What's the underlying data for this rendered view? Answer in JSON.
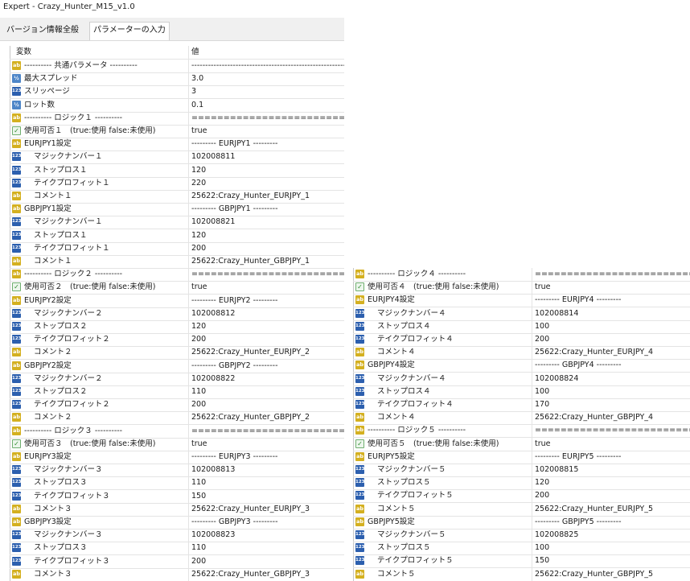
{
  "window": {
    "title": "Expert - Crazy_Hunter_M15_v1.0"
  },
  "tabs": [
    {
      "label": "バージョン情報",
      "active": false
    },
    {
      "label": "全般",
      "active": false
    },
    {
      "label": "パラメーターの入力",
      "active": true
    }
  ],
  "table": {
    "columns": {
      "variable": "変数",
      "value": "値"
    },
    "left_rows": [
      {
        "icon": "ab",
        "name": "----------   共通パラメータ   ----------",
        "value": "-------------------------------------------------------------------------------",
        "indent": false
      },
      {
        "icon": "half",
        "name": "最大スプレッド",
        "value": "3.0",
        "indent": false
      },
      {
        "icon": "123",
        "name": "スリッページ",
        "value": "3",
        "indent": false
      },
      {
        "icon": "half",
        "name": "ロット数",
        "value": "0.1",
        "indent": false
      },
      {
        "icon": "ab",
        "name": "----------   ロジック１   ----------",
        "value": "=====================================",
        "indent": false
      },
      {
        "icon": "bool",
        "name": "使用可否１　(true:使用  false:未使用)",
        "value": "true",
        "indent": false
      },
      {
        "icon": "ab",
        "name": "EURJPY1設定",
        "value": "---------  EURJPY1 ---------",
        "indent": false
      },
      {
        "icon": "123",
        "name": "マジックナンバー１",
        "value": "102008811",
        "indent": true
      },
      {
        "icon": "123",
        "name": "ストップロス１",
        "value": "120",
        "indent": true
      },
      {
        "icon": "123",
        "name": "テイクプロフィット１",
        "value": "220",
        "indent": true
      },
      {
        "icon": "ab",
        "name": "コメント１",
        "value": "25622:Crazy_Hunter_EURJPY_1",
        "indent": true
      },
      {
        "icon": "ab",
        "name": "GBPJPY1設定",
        "value": "---------  GBPJPY1 ---------",
        "indent": false
      },
      {
        "icon": "123",
        "name": "マジックナンバー１",
        "value": "102008821",
        "indent": true
      },
      {
        "icon": "123",
        "name": "ストップロス１",
        "value": "120",
        "indent": true
      },
      {
        "icon": "123",
        "name": "テイクプロフィット１",
        "value": "200",
        "indent": true
      },
      {
        "icon": "ab",
        "name": "コメント１",
        "value": "25622:Crazy_Hunter_GBPJPY_1",
        "indent": true
      },
      {
        "icon": "ab",
        "name": "----------   ロジック２   ----------",
        "value": "=====================================",
        "indent": false
      },
      {
        "icon": "bool",
        "name": "使用可否２　(true:使用  false:未使用)",
        "value": "true",
        "indent": false
      },
      {
        "icon": "ab",
        "name": "EURJPY2設定",
        "value": "---------  EURJPY2 ---------",
        "indent": false
      },
      {
        "icon": "123",
        "name": "マジックナンバー２",
        "value": "102008812",
        "indent": true
      },
      {
        "icon": "123",
        "name": "ストップロス２",
        "value": "120",
        "indent": true
      },
      {
        "icon": "123",
        "name": "テイクプロフィット２",
        "value": "200",
        "indent": true
      },
      {
        "icon": "ab",
        "name": "コメント２",
        "value": "25622:Crazy_Hunter_EURJPY_2",
        "indent": true
      },
      {
        "icon": "ab",
        "name": "GBPJPY2設定",
        "value": "---------  GBPJPY2 ---------",
        "indent": false
      },
      {
        "icon": "123",
        "name": "マジックナンバー２",
        "value": "102008822",
        "indent": true
      },
      {
        "icon": "123",
        "name": "ストップロス２",
        "value": "110",
        "indent": true
      },
      {
        "icon": "123",
        "name": "テイクプロフィット２",
        "value": "200",
        "indent": true
      },
      {
        "icon": "ab",
        "name": "コメント２",
        "value": "25622:Crazy_Hunter_GBPJPY_2",
        "indent": true
      },
      {
        "icon": "ab",
        "name": "----------   ロジック３   ----------",
        "value": "=====================================",
        "indent": false
      },
      {
        "icon": "bool",
        "name": "使用可否３　(true:使用  false:未使用)",
        "value": "true",
        "indent": false
      },
      {
        "icon": "ab",
        "name": "EURJPY3設定",
        "value": "---------  EURJPY3 ---------",
        "indent": false
      },
      {
        "icon": "123",
        "name": "マジックナンバー３",
        "value": "102008813",
        "indent": true
      },
      {
        "icon": "123",
        "name": "ストップロス３",
        "value": "110",
        "indent": true
      },
      {
        "icon": "123",
        "name": "テイクプロフィット３",
        "value": "150",
        "indent": true
      },
      {
        "icon": "ab",
        "name": "コメント３",
        "value": "25622:Crazy_Hunter_EURJPY_3",
        "indent": true
      },
      {
        "icon": "ab",
        "name": "GBPJPY3設定",
        "value": "---------  GBPJPY3 ---------",
        "indent": false
      },
      {
        "icon": "123",
        "name": "マジックナンバー３",
        "value": "102008823",
        "indent": true
      },
      {
        "icon": "123",
        "name": "ストップロス３",
        "value": "110",
        "indent": true
      },
      {
        "icon": "123",
        "name": "テイクプロフィット３",
        "value": "200",
        "indent": true
      },
      {
        "icon": "ab",
        "name": "コメント３",
        "value": "25622:Crazy_Hunter_GBPJPY_3",
        "indent": true
      }
    ],
    "right_rows": [
      {
        "icon": "ab",
        "name": "----------   ロジック４   ----------",
        "value": "=====================================",
        "indent": false
      },
      {
        "icon": "bool",
        "name": "使用可否４　(true:使用  false:未使用)",
        "value": "true",
        "indent": false
      },
      {
        "icon": "ab",
        "name": "EURJPY4設定",
        "value": "---------  EURJPY4 ---------",
        "indent": false
      },
      {
        "icon": "123",
        "name": "マジックナンバー４",
        "value": "102008814",
        "indent": true
      },
      {
        "icon": "123",
        "name": "ストップロス４",
        "value": "100",
        "indent": true
      },
      {
        "icon": "123",
        "name": "テイクプロフィット４",
        "value": "200",
        "indent": true
      },
      {
        "icon": "ab",
        "name": "コメント４",
        "value": "25622:Crazy_Hunter_EURJPY_4",
        "indent": true
      },
      {
        "icon": "ab",
        "name": "GBPJPY4設定",
        "value": "---------  GBPJPY4 ---------",
        "indent": false
      },
      {
        "icon": "123",
        "name": "マジックナンバー４",
        "value": "102008824",
        "indent": true
      },
      {
        "icon": "123",
        "name": "ストップロス４",
        "value": "100",
        "indent": true
      },
      {
        "icon": "123",
        "name": "テイクプロフィット４",
        "value": "170",
        "indent": true
      },
      {
        "icon": "ab",
        "name": "コメント４",
        "value": "25622:Crazy_Hunter_GBPJPY_4",
        "indent": true
      },
      {
        "icon": "ab",
        "name": "----------   ロジック５   ----------",
        "value": "=====================================",
        "indent": false
      },
      {
        "icon": "bool",
        "name": "使用可否５　(true:使用  false:未使用)",
        "value": "true",
        "indent": false
      },
      {
        "icon": "ab",
        "name": "EURJPY5設定",
        "value": "---------  EURJPY5 ---------",
        "indent": false
      },
      {
        "icon": "123",
        "name": "マジックナンバー５",
        "value": "102008815",
        "indent": true
      },
      {
        "icon": "123",
        "name": "ストップロス５",
        "value": "120",
        "indent": true
      },
      {
        "icon": "123",
        "name": "テイクプロフィット５",
        "value": "200",
        "indent": true
      },
      {
        "icon": "ab",
        "name": "コメント５",
        "value": "25622:Crazy_Hunter_EURJPY_5",
        "indent": true
      },
      {
        "icon": "ab",
        "name": "GBPJPY5設定",
        "value": "---------  GBPJPY5 ---------",
        "indent": false
      },
      {
        "icon": "123",
        "name": "マジックナンバー５",
        "value": "102008825",
        "indent": true
      },
      {
        "icon": "123",
        "name": "ストップロス５",
        "value": "100",
        "indent": true
      },
      {
        "icon": "123",
        "name": "テイクプロフィット５",
        "value": "150",
        "indent": true
      },
      {
        "icon": "ab",
        "name": "コメント５",
        "value": "25622:Crazy_Hunter_GBPJPY_5",
        "indent": true
      }
    ]
  }
}
